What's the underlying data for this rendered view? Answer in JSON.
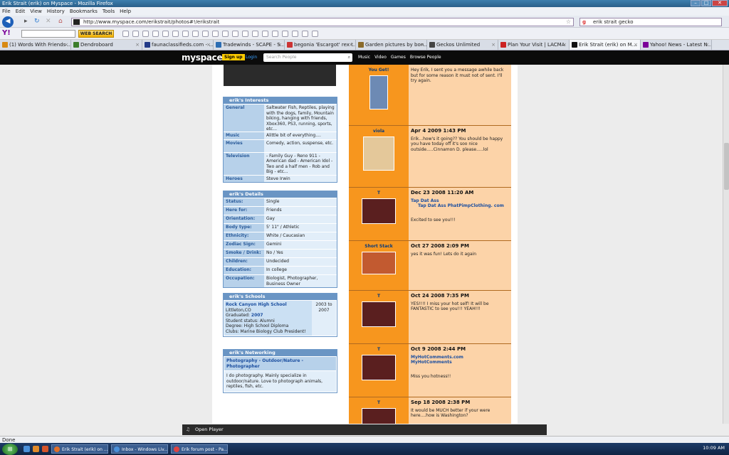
{
  "window": {
    "title": "Erik Strait (erik) on Myspace - Mozilla Firefox"
  },
  "menu": [
    "File",
    "Edit",
    "View",
    "History",
    "Bookmarks",
    "Tools",
    "Help"
  ],
  "nav": {
    "url": "http://www.myspace.com/erikstrait/photos#!/erikstrait",
    "search": "erik strait gecko"
  },
  "yahoo_toolbar": {
    "logo": "Y!",
    "button": "WEB SEARCH"
  },
  "tabs": [
    {
      "label": "(1) Words With Friends ...",
      "color": "#d88a14"
    },
    {
      "label": "Dendroboard",
      "color": "#3b7d2b"
    },
    {
      "label": "faunaclassifieds.com - ...",
      "color": "#223a88"
    },
    {
      "label": "Tradewinds - SCAPE - S...",
      "color": "#2c6db3"
    },
    {
      "label": "begonia 'Escargot' rex t...",
      "color": "#cc3333"
    },
    {
      "label": "Garden pictures by bon...",
      "color": "#8a6a2a"
    },
    {
      "label": "Geckos Unlimited",
      "color": "#444"
    },
    {
      "label": "Plan Your Visit | LACMA",
      "color": "#cc2222"
    },
    {
      "label": "Erik Strait (erik) on M...",
      "color": "#111"
    },
    {
      "label": "Yahoo! News - Latest N...",
      "color": "#7b0099"
    }
  ],
  "myspace": {
    "logo": "myspace",
    "signup": "Sign up",
    "login": "Login",
    "search_placeholder": "Search People",
    "nav": [
      "Music",
      "Video",
      "Games",
      "Browse People"
    ]
  },
  "interests": {
    "title": "erik's Interests",
    "rows": [
      {
        "label": "General",
        "value": "Saltwater Fish, Reptiles, playing with the dogs, family, Mountain biking, hanging with friends, Xbox360, PS3, running, sports, etc..."
      },
      {
        "label": "Music",
        "value": "Alittle bit of everything...."
      },
      {
        "label": "Movies",
        "value": "Comedy, action, suspense, etc."
      },
      {
        "label": "Television",
        "value": "- Family Guy - Reno 911 - American dad - American Idol - Two and a half men - Rob and Big - etc..."
      },
      {
        "label": "Heroes",
        "value": "Steve Irwin"
      }
    ]
  },
  "details": {
    "title": "erik's Details",
    "rows": [
      {
        "label": "Status:",
        "value": "Single"
      },
      {
        "label": "Here for:",
        "value": "Friends"
      },
      {
        "label": "Orientation:",
        "value": "Gay"
      },
      {
        "label": "Body type:",
        "value": "5' 11\" / Athletic"
      },
      {
        "label": "Ethnicity:",
        "value": "White / Caucasian"
      },
      {
        "label": "Zodiac Sign:",
        "value": "Gemini"
      },
      {
        "label": "Smoke / Drink:",
        "value": "No / Yes"
      },
      {
        "label": "Children:",
        "value": "Undecided"
      },
      {
        "label": "Education:",
        "value": "In college"
      },
      {
        "label": "Occupation:",
        "value": "Biologist, Photographer, Business Owner"
      }
    ]
  },
  "schools": {
    "title": "erik's Schools",
    "name": "Rock Canyon High School",
    "location": "Littleton,CO",
    "graduated_label": "Graduated:",
    "graduated": "2007",
    "status": "Student status: Alumni",
    "degree": "Degree: High School Diploma",
    "clubs": "Clubs: Marine Biology Club President!",
    "years": "2003 to 2007"
  },
  "networking": {
    "title": "erik's Networking",
    "field": "Photography - Outdoor/Nature - Photographer",
    "desc": "I do photography. Mainly specialize in outdoor/nature. Love to photograph animals, reptiles, fish, etc."
  },
  "comments": [
    {
      "name": "You Get!",
      "date": "",
      "text": "Hey Erik, I sent you a message awhile back but for some reason it must not of sent. I'll try again.",
      "link1": "",
      "link2": "",
      "extra": "",
      "pic_color": "#6d8ab4"
    },
    {
      "name": "viola",
      "date": "Apr 4 2009 1:43 PM",
      "text": "Erik...how's it going?? You should be happy you have today off it's soo nice outside.....Cinnamon D. please.....lol",
      "link1": "",
      "link2": "",
      "extra": "",
      "pic_color": "#e4c89a"
    },
    {
      "name": "T",
      "date": "Dec 23 2008 11:20 AM",
      "text": "",
      "link1": "Tap Dat Ass",
      "link2": "Tap Dat Ass PhatPimpClothing. com",
      "extra": "Excited to see you!!!",
      "pic_color": "#5a1f22"
    },
    {
      "name": "Short Stack",
      "date": "Oct 27 2008 2:09 PM",
      "text": "yes it was fun! Lets do it again",
      "link1": "",
      "link2": "",
      "extra": "",
      "pic_color": "#c25a30"
    },
    {
      "name": "T",
      "date": "Oct 24 2008 7:35 PM",
      "text": "YES!!!! I miss your hot self! It will be FANTASTIC to see you!!! YEAH!!!",
      "link1": "",
      "link2": "",
      "extra": "",
      "pic_color": "#5a1f22"
    },
    {
      "name": "T",
      "date": "Oct 9 2008 2:44 PM",
      "text": "",
      "link1": "MyHotComments.com",
      "link2": "MyHotComments",
      "extra": "Miss you hotness!!",
      "pic_color": "#5a1f22"
    },
    {
      "name": "T",
      "date": "Sep 18 2008 2:38 PM",
      "text": "It would be MUCH better if your were here....how is Washington?",
      "link1": "",
      "link2": "",
      "extra": "",
      "pic_color": "#5a1f22"
    }
  ],
  "status": {
    "text": "Done"
  },
  "openplayer": {
    "label": "Open Player"
  },
  "taskbar": {
    "items": [
      "Erik Strait (erik) on ...",
      "Inbox - Windows Liv...",
      "Erik forum post - Pa..."
    ],
    "clock": "10:09 AM"
  },
  "colors": {
    "myspace_black": "#0b0b0b",
    "panel_blue": "#6a95c4",
    "comment_orange": "#f7961e",
    "comment_peach": "#fcd3a8"
  }
}
